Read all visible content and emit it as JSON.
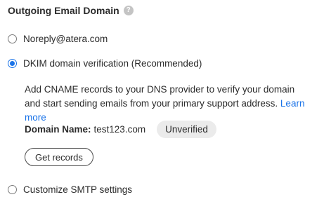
{
  "section": {
    "title": "Outgoing Email Domain",
    "help_icon": "question-circle-icon"
  },
  "options": [
    {
      "label": "Noreply@atera.com",
      "selected": false
    },
    {
      "label": "DKIM domain verification (Recommended)",
      "selected": true
    },
    {
      "label": "Customize SMTP settings",
      "selected": false
    }
  ],
  "dkim": {
    "description": "Add CNAME records to your DNS provider to verify your domain and start sending emails from your primary support address.",
    "learn_more": "Learn more",
    "domain_label": "Domain Name:",
    "domain_value": "test123.com",
    "status": "Unverified",
    "get_records_label": "Get records"
  },
  "colors": {
    "accent": "#1a73e8",
    "badge_bg": "#ebebeb",
    "help_icon_bg": "#c4c4c4"
  }
}
